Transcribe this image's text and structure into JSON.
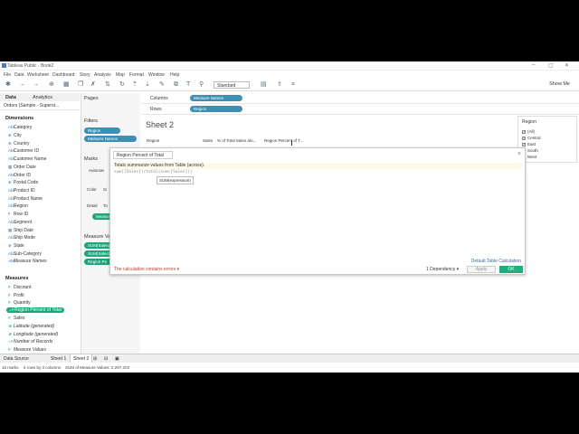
{
  "window": {
    "title": "Tableau Public - Book2",
    "minimize": "–",
    "maximize": "▢",
    "close": "✕"
  },
  "menu": [
    "File",
    "Data",
    "Worksheet",
    "Dashboard",
    "Story",
    "Analysis",
    "Map",
    "Format",
    "Window",
    "Help"
  ],
  "toolbar": {
    "view_mode": "Standard",
    "show_me": "Show Me"
  },
  "left_tabs": {
    "data": "Data",
    "analytics": "Analytics"
  },
  "data_source": "Orders (Sample - Superst...",
  "dimensions": {
    "header": "Dimensions",
    "items": [
      "Category",
      "City",
      "Country",
      "Customer ID",
      "Customer Name",
      "Order Date",
      "Order ID",
      "Postal Code",
      "Product ID",
      "Product Name",
      "Region",
      "Row ID",
      "Segment",
      "Ship Date",
      "Ship Mode",
      "State",
      "Sub-Category",
      "Measure Names"
    ]
  },
  "measures": {
    "header": "Measures",
    "items": [
      "Discount",
      "Profit",
      "Quantity",
      "Region Percent of Total",
      "Sales",
      "Latitude (generated)",
      "Longitude (generated)",
      "Number of Records",
      "Measure Values"
    ]
  },
  "pages_label": "Pages",
  "filters": {
    "label": "Filters",
    "pills": [
      "Region",
      "Measure Names"
    ]
  },
  "marks": {
    "label": "Marks",
    "type": "Automat",
    "color": "Color",
    "size": "Si",
    "detail": "Detail",
    "tooltip": "To",
    "pill": "Measure"
  },
  "measure_values": {
    "label": "Measure Valu",
    "pills": [
      "SUM(Sales)",
      "SUM(Sales)",
      "Region Pe"
    ]
  },
  "shelves": {
    "columns_label": "Columns",
    "columns_pill": "Measure Names",
    "rows_label": "Rows",
    "rows_pill": "Region"
  },
  "sheet": {
    "title": "Sheet 2",
    "headers": [
      "Region",
      "Sales",
      "% of Total Sales alo...",
      "Region Percent of T..."
    ]
  },
  "legend": {
    "title": "Region",
    "items": [
      "(All)",
      "Central",
      "East",
      "South",
      "West"
    ]
  },
  "dialog": {
    "title": "Region Percent of Total",
    "hint": "Totals summarize values from Table (across).",
    "expression": "sum([Sales])/total(sum([Sales]))",
    "tooltip": "SUM(expression)",
    "error": "The calculation contains errors ▾",
    "default_link": "Default Table Calculation",
    "dependency": "1 Dependency ▾",
    "apply": "Apply",
    "ok": "OK"
  },
  "sheet_tabs": {
    "data_source": "Data Source",
    "sheet1": "Sheet 1",
    "sheet2": "Sheet 2"
  },
  "status": {
    "marks": "15 marks",
    "dims": "5 rows by 3 columns",
    "sum": "SUM of Measure Values: 2,297,203"
  }
}
